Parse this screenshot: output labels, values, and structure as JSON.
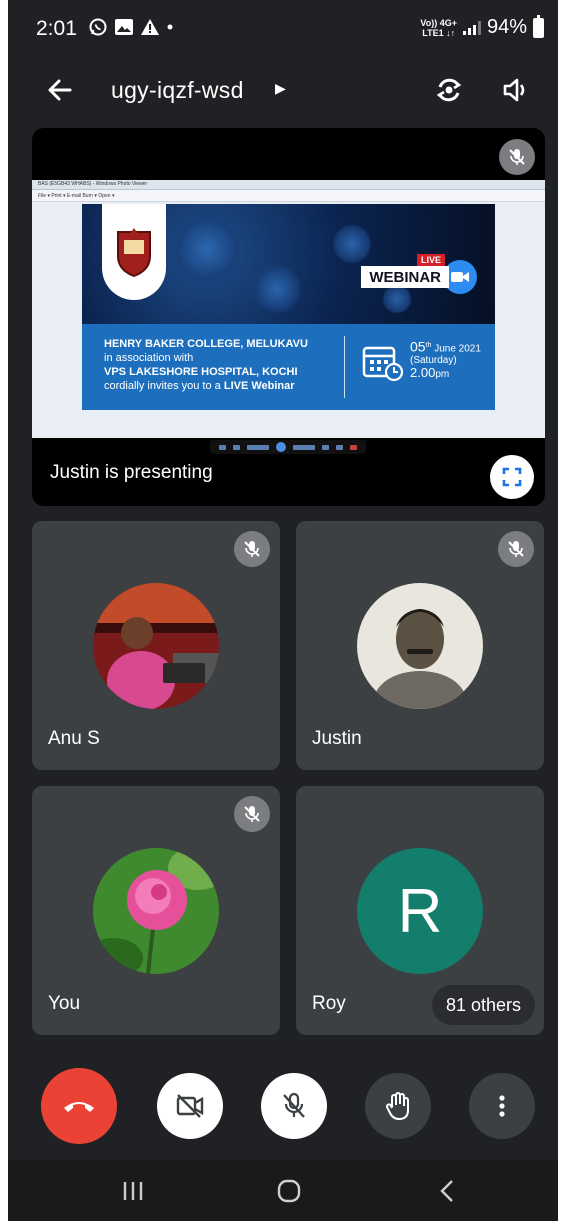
{
  "status_bar": {
    "time": "2:01",
    "network_top": "Vo)) 4G+",
    "network_bottom": "LTE1 ↓↑",
    "battery": "94%"
  },
  "header": {
    "meeting_code": "ugy-iqzf-wsd",
    "back_icon": "arrow-left-icon",
    "switch_camera_icon": "switch-camera-icon",
    "speaker_icon": "speaker-icon"
  },
  "presentation": {
    "label": "Justin is presenting",
    "window_title": "BAS (E5GB43 WHABS) - Windows Photo Viewer",
    "window_menu": "File ▾   Print ▾   E-mail   Burn ▾   Open ▾",
    "poster": {
      "live": "LIVE",
      "webinar": "WEBINAR",
      "line1": "HENRY BAKER COLLEGE, MELUKAVU",
      "line2": "in association with",
      "line3": "VPS LAKESHORE HOSPITAL, KOCHI",
      "line4_prefix": "cordially invites you to a ",
      "line4_bold": "LIVE Webinar",
      "date_day": "05",
      "date_sup": "th",
      "date_rest": " June 2021",
      "date_weekday": "(Saturday)",
      "date_time": "2.00",
      "date_time_unit": "pm"
    }
  },
  "participants": [
    {
      "name": "Anu S",
      "muted": true
    },
    {
      "name": "Justin",
      "muted": true
    },
    {
      "name": "You",
      "muted": true
    },
    {
      "name": "Roy",
      "avatar_letter": "R",
      "muted": false,
      "avatar_color": "#137e6c"
    }
  ],
  "others_count": "81 others",
  "controls": {
    "end_call_color": "#ea4335",
    "icons": [
      "end-call-icon",
      "camera-off-icon",
      "mic-off-icon",
      "raise-hand-icon",
      "more-vert-icon"
    ]
  },
  "colors": {
    "background": "#202124",
    "tile": "#3c4043",
    "accent_end": "#ea4335"
  }
}
